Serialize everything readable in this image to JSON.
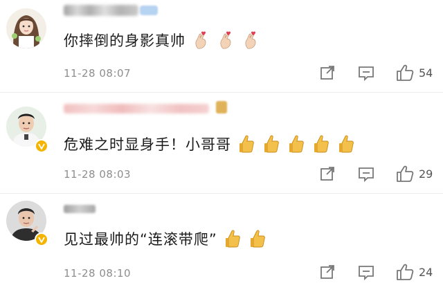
{
  "comments": [
    {
      "text": "你摔倒的身影真帅",
      "emoji": [
        "finger-heart-emoji",
        "finger-heart-emoji",
        "finger-heart-emoji"
      ],
      "time": "11-28 08:07",
      "likes": "54",
      "verified": false
    },
    {
      "text": "危难之时显身手！小哥哥",
      "emoji": [
        "thumbs-up-emoji",
        "thumbs-up-emoji",
        "thumbs-up-emoji",
        "thumbs-up-emoji",
        "thumbs-up-emoji"
      ],
      "time": "11-28 08:03",
      "likes": "29",
      "verified": true
    },
    {
      "text": "见过最帅的“连滚带爬”",
      "emoji": [
        "thumbs-up-emoji",
        "thumbs-up-emoji"
      ],
      "time": "11-28 08:10",
      "likes": "24",
      "verified": true
    }
  ],
  "actions": [
    "share-icon",
    "reply-icon",
    "like-icon"
  ],
  "colors": {
    "time": "#8e8e8e",
    "verified_badge": "#f5b400",
    "divider": "#ececec"
  }
}
